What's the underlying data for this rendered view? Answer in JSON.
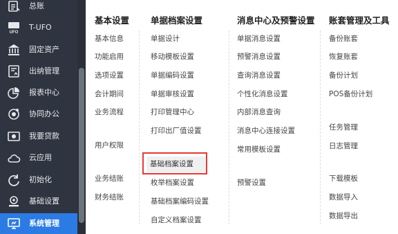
{
  "sidebar": {
    "items": [
      {
        "label": "总账",
        "icon": "ledger-icon",
        "active": false
      },
      {
        "label": "T-UFO",
        "icon": "ufo-report-icon",
        "active": false
      },
      {
        "label": "固定资产",
        "icon": "bank-building-icon",
        "active": false
      },
      {
        "label": "出纳管理",
        "icon": "cashier-icon",
        "active": false
      },
      {
        "label": "报表中心",
        "icon": "pie-chart-icon",
        "active": false
      },
      {
        "label": "协同办公",
        "icon": "collaboration-icon",
        "active": false
      },
      {
        "label": "我要贷款",
        "icon": "loan-icon",
        "active": false
      },
      {
        "label": "云应用",
        "icon": "cloud-icon",
        "active": false
      },
      {
        "label": "初始化",
        "icon": "refresh-icon",
        "active": false
      },
      {
        "label": "基础设置",
        "icon": "settings-gear-icon",
        "active": false
      },
      {
        "label": "系统管理",
        "icon": "system-management-icon",
        "active": true
      }
    ]
  },
  "menu": {
    "col1": {
      "header": "基本设置",
      "items": [
        "基本信息",
        "功能启用",
        "选项设置",
        "会计期间",
        "业务流程",
        "用户权限",
        "业务结账",
        "财务结账"
      ]
    },
    "col2": {
      "header": "单据档案设置",
      "items": [
        "单据设计",
        "移动模板设置",
        "单据编码设置",
        "单据审核设置",
        "打印管理中心",
        "打印出厂值设置",
        "基础档案设置",
        "枚举档案设置",
        "基础档案编码设置",
        "自定义档案设置"
      ]
    },
    "col3": {
      "header": "消息中心及预警设置",
      "items": [
        "单据消息设置",
        "预警消息设置",
        "查询消息设置",
        "个性化消息设置",
        "内部消息查询",
        "消息中心连接设置",
        "常用模板设置",
        "预警设置"
      ]
    },
    "col4": {
      "header": "账套管理及工具",
      "items": [
        "备份账套",
        "恢复账套",
        "备份计划",
        "POS备份计划",
        "任务管理",
        "日志管理",
        "下载模板",
        "数据导入",
        "数据导出"
      ]
    }
  },
  "highlight_color": "#e53935",
  "active_nav_color": "#2c7be5",
  "sidebar_color": "#2f3540"
}
